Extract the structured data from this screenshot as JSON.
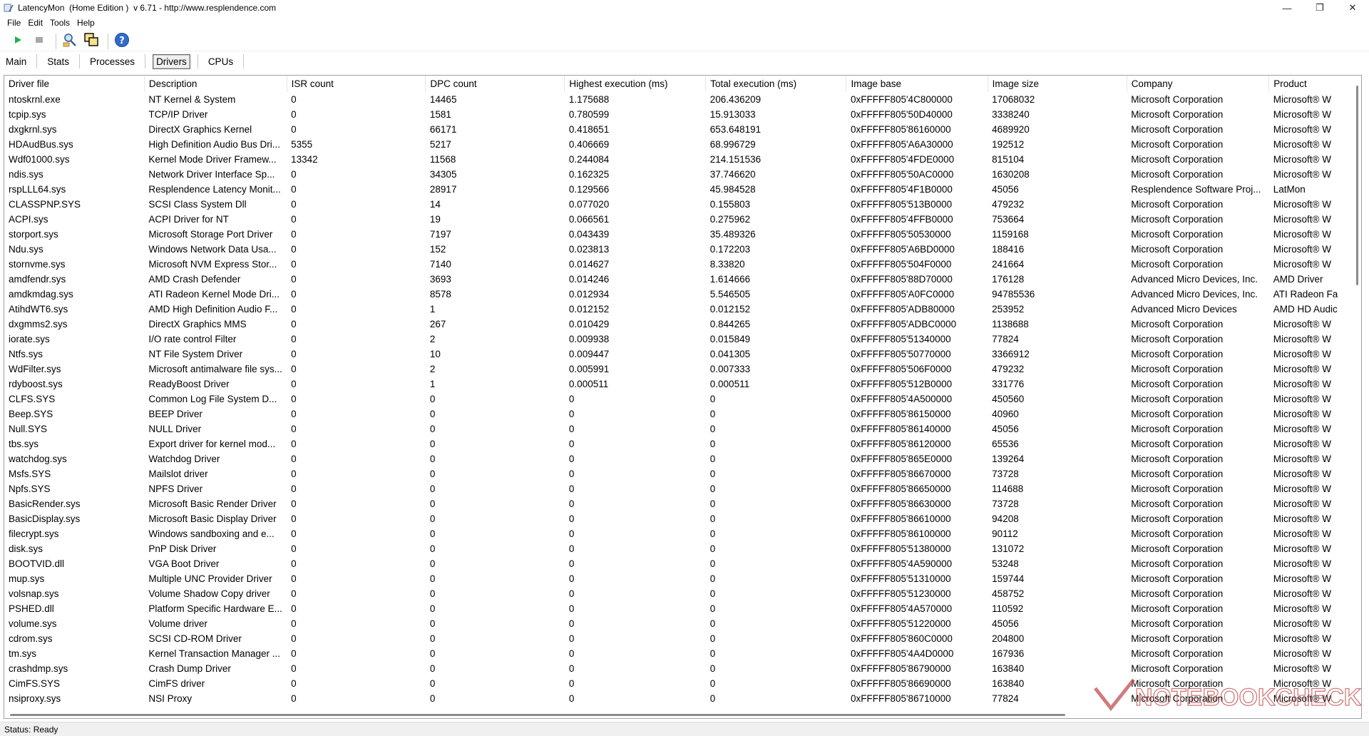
{
  "window": {
    "title": "LatencyMon  (Home Edition )  v 6.71 - http://www.resplendence.com",
    "minimize": "—",
    "maximize": "❐",
    "close": "✕"
  },
  "menu": [
    "File",
    "Edit",
    "Tools",
    "Help"
  ],
  "toolbar": {
    "buttons": [
      "start-icon",
      "stop-icon",
      "analyze-icon",
      "copy-icon",
      "help-icon"
    ]
  },
  "tabs": [
    {
      "label": "Main"
    },
    {
      "label": "Stats"
    },
    {
      "label": "Processes"
    },
    {
      "label": "Drivers",
      "active": true
    },
    {
      "label": "CPUs"
    }
  ],
  "grid": {
    "columns": [
      "Driver file",
      "Description",
      "ISR count",
      "DPC count",
      "Highest execution (ms)",
      "Total execution (ms)",
      "Image base",
      "Image size",
      "Company",
      "Product"
    ],
    "rows": [
      [
        "ntoskrnl.exe",
        "NT Kernel & System",
        "0",
        "14465",
        "1.175688",
        "206.436209",
        "0xFFFFF805'4C800000",
        "17068032",
        "Microsoft Corporation",
        "Microsoft® W"
      ],
      [
        "tcpip.sys",
        "TCP/IP Driver",
        "0",
        "1581",
        "0.780599",
        "15.913033",
        "0xFFFFF805'50D40000",
        "3338240",
        "Microsoft Corporation",
        "Microsoft® W"
      ],
      [
        "dxgkrnl.sys",
        "DirectX Graphics Kernel",
        "0",
        "66171",
        "0.418651",
        "653.648191",
        "0xFFFFF805'86160000",
        "4689920",
        "Microsoft Corporation",
        "Microsoft® W"
      ],
      [
        "HDAudBus.sys",
        "High Definition Audio Bus Dri...",
        "5355",
        "5217",
        "0.406669",
        "68.996729",
        "0xFFFFF805'A6A30000",
        "192512",
        "Microsoft Corporation",
        "Microsoft® W"
      ],
      [
        "Wdf01000.sys",
        "Kernel Mode Driver Framew...",
        "13342",
        "11568",
        "0.244084",
        "214.151536",
        "0xFFFFF805'4FDE0000",
        "815104",
        "Microsoft Corporation",
        "Microsoft® W"
      ],
      [
        "ndis.sys",
        "Network Driver Interface Sp...",
        "0",
        "34305",
        "0.162325",
        "37.746620",
        "0xFFFFF805'50AC0000",
        "1630208",
        "Microsoft Corporation",
        "Microsoft® W"
      ],
      [
        "rspLLL64.sys",
        "Resplendence Latency Monit...",
        "0",
        "28917",
        "0.129566",
        "45.984528",
        "0xFFFFF805'4F1B0000",
        "45056",
        "Resplendence Software Proj...",
        "LatMon"
      ],
      [
        "CLASSPNP.SYS",
        "SCSI Class System Dll",
        "0",
        "14",
        "0.077020",
        "0.155803",
        "0xFFFFF805'513B0000",
        "479232",
        "Microsoft Corporation",
        "Microsoft® W"
      ],
      [
        "ACPI.sys",
        "ACPI Driver for NT",
        "0",
        "19",
        "0.066561",
        "0.275962",
        "0xFFFFF805'4FFB0000",
        "753664",
        "Microsoft Corporation",
        "Microsoft® W"
      ],
      [
        "storport.sys",
        "Microsoft Storage Port Driver",
        "0",
        "7197",
        "0.043439",
        "35.489326",
        "0xFFFFF805'50530000",
        "1159168",
        "Microsoft Corporation",
        "Microsoft® W"
      ],
      [
        "Ndu.sys",
        "Windows Network Data Usa...",
        "0",
        "152",
        "0.023813",
        "0.172203",
        "0xFFFFF805'A6BD0000",
        "188416",
        "Microsoft Corporation",
        "Microsoft® W"
      ],
      [
        "stornvme.sys",
        "Microsoft NVM Express Stor...",
        "0",
        "7140",
        "0.014627",
        "8.33820",
        "0xFFFFF805'504F0000",
        "241664",
        "Microsoft Corporation",
        "Microsoft® W"
      ],
      [
        "amdfendr.sys",
        "AMD Crash Defender",
        "0",
        "3693",
        "0.014246",
        "1.614666",
        "0xFFFFF805'88D70000",
        "176128",
        "Advanced Micro Devices, Inc.",
        "AMD Driver"
      ],
      [
        "amdkmdag.sys",
        "ATI Radeon Kernel Mode Dri...",
        "0",
        "8578",
        "0.012934",
        "5.546505",
        "0xFFFFF805'A0FC0000",
        "94785536",
        "Advanced Micro Devices, Inc.",
        "ATI Radeon Fa"
      ],
      [
        "AtihdWT6.sys",
        "AMD High Definition Audio F...",
        "0",
        "1",
        "0.012152",
        "0.012152",
        "0xFFFFF805'ADB80000",
        "253952",
        "Advanced Micro Devices",
        "AMD HD Audic"
      ],
      [
        "dxgmms2.sys",
        "DirectX Graphics MMS",
        "0",
        "267",
        "0.010429",
        "0.844265",
        "0xFFFFF805'ADBC0000",
        "1138688",
        "Microsoft Corporation",
        "Microsoft® W"
      ],
      [
        "iorate.sys",
        "I/O rate control Filter",
        "0",
        "2",
        "0.009938",
        "0.015849",
        "0xFFFFF805'51340000",
        "77824",
        "Microsoft Corporation",
        "Microsoft® W"
      ],
      [
        "Ntfs.sys",
        "NT File System Driver",
        "0",
        "10",
        "0.009447",
        "0.041305",
        "0xFFFFF805'50770000",
        "3366912",
        "Microsoft Corporation",
        "Microsoft® W"
      ],
      [
        "WdFilter.sys",
        "Microsoft antimalware file sys...",
        "0",
        "2",
        "0.005991",
        "0.007333",
        "0xFFFFF805'506F0000",
        "479232",
        "Microsoft Corporation",
        "Microsoft® W"
      ],
      [
        "rdyboost.sys",
        "ReadyBoost Driver",
        "0",
        "1",
        "0.000511",
        "0.000511",
        "0xFFFFF805'512B0000",
        "331776",
        "Microsoft Corporation",
        "Microsoft® W"
      ],
      [
        "CLFS.SYS",
        "Common Log File System D...",
        "0",
        "0",
        "0",
        "0",
        "0xFFFFF805'4A500000",
        "450560",
        "Microsoft Corporation",
        "Microsoft® W"
      ],
      [
        "Beep.SYS",
        "BEEP Driver",
        "0",
        "0",
        "0",
        "0",
        "0xFFFFF805'86150000",
        "40960",
        "Microsoft Corporation",
        "Microsoft® W"
      ],
      [
        "Null.SYS",
        "NULL Driver",
        "0",
        "0",
        "0",
        "0",
        "0xFFFFF805'86140000",
        "45056",
        "Microsoft Corporation",
        "Microsoft® W"
      ],
      [
        "tbs.sys",
        "Export driver for kernel mod...",
        "0",
        "0",
        "0",
        "0",
        "0xFFFFF805'86120000",
        "65536",
        "Microsoft Corporation",
        "Microsoft® W"
      ],
      [
        "watchdog.sys",
        "Watchdog Driver",
        "0",
        "0",
        "0",
        "0",
        "0xFFFFF805'865E0000",
        "139264",
        "Microsoft Corporation",
        "Microsoft® W"
      ],
      [
        "Msfs.SYS",
        "Mailslot driver",
        "0",
        "0",
        "0",
        "0",
        "0xFFFFF805'86670000",
        "73728",
        "Microsoft Corporation",
        "Microsoft® W"
      ],
      [
        "Npfs.SYS",
        "NPFS Driver",
        "0",
        "0",
        "0",
        "0",
        "0xFFFFF805'86650000",
        "114688",
        "Microsoft Corporation",
        "Microsoft® W"
      ],
      [
        "BasicRender.sys",
        "Microsoft Basic Render Driver",
        "0",
        "0",
        "0",
        "0",
        "0xFFFFF805'86630000",
        "73728",
        "Microsoft Corporation",
        "Microsoft® W"
      ],
      [
        "BasicDisplay.sys",
        "Microsoft Basic Display Driver",
        "0",
        "0",
        "0",
        "0",
        "0xFFFFF805'86610000",
        "94208",
        "Microsoft Corporation",
        "Microsoft® W"
      ],
      [
        "filecrypt.sys",
        "Windows sandboxing and e...",
        "0",
        "0",
        "0",
        "0",
        "0xFFFFF805'86100000",
        "90112",
        "Microsoft Corporation",
        "Microsoft® W"
      ],
      [
        "disk.sys",
        "PnP Disk Driver",
        "0",
        "0",
        "0",
        "0",
        "0xFFFFF805'51380000",
        "131072",
        "Microsoft Corporation",
        "Microsoft® W"
      ],
      [
        "BOOTVID.dll",
        "VGA Boot Driver",
        "0",
        "0",
        "0",
        "0",
        "0xFFFFF805'4A590000",
        "53248",
        "Microsoft Corporation",
        "Microsoft® W"
      ],
      [
        "mup.sys",
        "Multiple UNC Provider Driver",
        "0",
        "0",
        "0",
        "0",
        "0xFFFFF805'51310000",
        "159744",
        "Microsoft Corporation",
        "Microsoft® W"
      ],
      [
        "volsnap.sys",
        "Volume Shadow Copy driver",
        "0",
        "0",
        "0",
        "0",
        "0xFFFFF805'51230000",
        "458752",
        "Microsoft Corporation",
        "Microsoft® W"
      ],
      [
        "PSHED.dll",
        "Platform Specific Hardware E...",
        "0",
        "0",
        "0",
        "0",
        "0xFFFFF805'4A570000",
        "110592",
        "Microsoft Corporation",
        "Microsoft® W"
      ],
      [
        "volume.sys",
        "Volume driver",
        "0",
        "0",
        "0",
        "0",
        "0xFFFFF805'51220000",
        "45056",
        "Microsoft Corporation",
        "Microsoft® W"
      ],
      [
        "cdrom.sys",
        "SCSI CD-ROM Driver",
        "0",
        "0",
        "0",
        "0",
        "0xFFFFF805'860C0000",
        "204800",
        "Microsoft Corporation",
        "Microsoft® W"
      ],
      [
        "tm.sys",
        "Kernel Transaction Manager ...",
        "0",
        "0",
        "0",
        "0",
        "0xFFFFF805'4A4D0000",
        "167936",
        "Microsoft Corporation",
        "Microsoft® W"
      ],
      [
        "crashdmp.sys",
        "Crash Dump Driver",
        "0",
        "0",
        "0",
        "0",
        "0xFFFFF805'86790000",
        "163840",
        "Microsoft Corporation",
        "Microsoft® W"
      ],
      [
        "CimFS.SYS",
        "CimFS driver",
        "0",
        "0",
        "0",
        "0",
        "0xFFFFF805'86690000",
        "163840",
        "Microsoft Corporation",
        "Microsoft® W"
      ],
      [
        "nsiproxy.sys",
        "NSI Proxy",
        "0",
        "0",
        "0",
        "0",
        "0xFFFFF805'86710000",
        "77824",
        "Microsoft Corporation",
        "Microsoft® W"
      ]
    ]
  },
  "status": {
    "text": "Status: Ready"
  },
  "watermark": {
    "text": "NOTEBOOKCHECK",
    "color": "#c05050"
  }
}
